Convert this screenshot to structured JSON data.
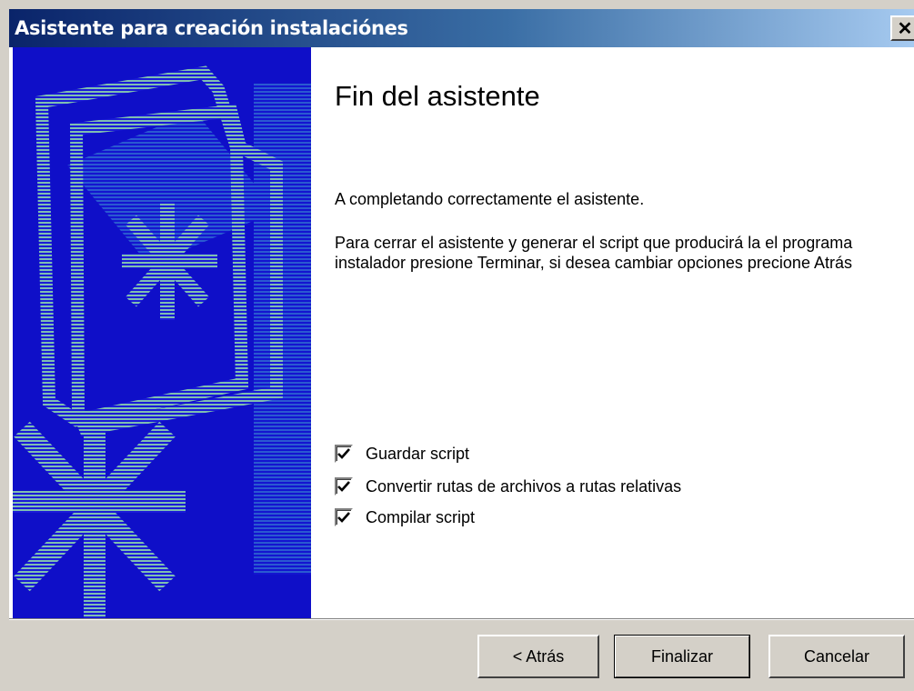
{
  "window": {
    "title": "Asistente para creación instalaciónes",
    "close_glyph": "✕"
  },
  "main": {
    "heading": "Fin del asistente",
    "paragraph1": "A completando correctamente el asistente.",
    "paragraph2": "Para cerrar el asistente y generar el script que producirá la el programa instalador presione Terminar, si desea cambiar opciones precione Atrás",
    "options": [
      {
        "label": "Guardar script",
        "checked": true
      },
      {
        "label": "Convertir rutas de archivos a rutas relativas",
        "checked": true
      },
      {
        "label": "Compilar script",
        "checked": true
      }
    ]
  },
  "buttons": {
    "back": "< Atrás",
    "finish": "Finalizar",
    "cancel": "Cancelar"
  },
  "colors": {
    "sidebar_blue": "#0f0fc8",
    "graphic_teal": "#7fbfb0",
    "title_gradient_start": "#0a246a"
  },
  "icons": {
    "sidebar_graphic": "folder-with-asterisk-graphic",
    "check": "check-mark-icon"
  }
}
